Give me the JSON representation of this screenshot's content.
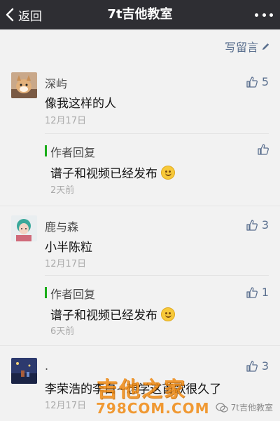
{
  "navbar": {
    "back_label": "返回",
    "title": "7t吉他教室"
  },
  "write_comment": {
    "label": "写留言",
    "icon": "pencil-icon"
  },
  "comments": [
    {
      "nickname": "深屿",
      "text": "像我这样的人",
      "date": "12月17日",
      "likes": "5",
      "reply": {
        "author": "作者回复",
        "text": "谱子和视频已经发布",
        "date": "2天前"
      }
    },
    {
      "nickname": "鹿与森",
      "text": "小半陈粒",
      "date": "12月17日",
      "likes": "3",
      "reply": {
        "author": "作者回复",
        "text": "谱子和视频已经发布",
        "date": "6天前",
        "likes": "1"
      }
    },
    {
      "nickname": ".",
      "text": "李荣浩的李白~想学这首歌很久了",
      "date": "12月17日",
      "likes": "3"
    }
  ],
  "watermark": {
    "big": "吉他之家",
    "small": "798COM.COM"
  },
  "account_mark": "7t吉他教室",
  "colors": {
    "navbar": "#2e2e33",
    "link": "#5b708f",
    "reply_bar": "#1aad19",
    "background": "#f2f2f2",
    "watermark": "#f08a12"
  }
}
